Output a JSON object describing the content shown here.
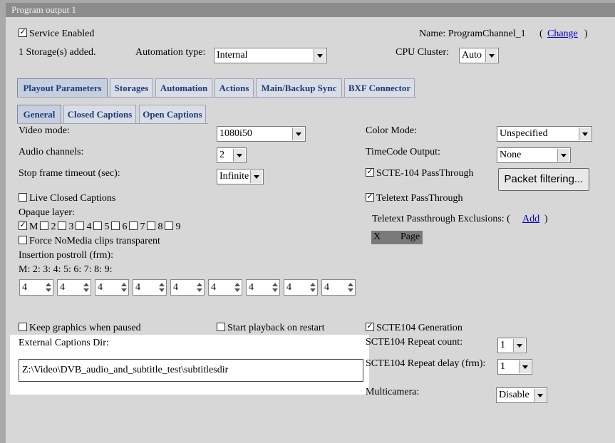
{
  "window": {
    "title": "Program output 1"
  },
  "header": {
    "service_enabled": "Service Enabled",
    "storages_added": "1 Storage(s) added.",
    "automation_type_label": "Automation type:",
    "automation_type_value": "Internal",
    "name_label": "Name: ProgramChannel_1",
    "paren_open": "(",
    "change_link": "Change",
    "paren_close": ")",
    "cpu_cluster_label": "CPU Cluster:",
    "cpu_cluster_value": "Auto"
  },
  "tabs_main": [
    "Playout Parameters",
    "Storages",
    "Automation",
    "Actions",
    "Main/Backup Sync",
    "BXF Connector"
  ],
  "tabs_sub": [
    "General",
    "Closed Captions",
    "Open Captions"
  ],
  "left": {
    "video_mode_label": "Video mode:",
    "video_mode_value": "1080i50",
    "audio_channels_label": "Audio channels:",
    "audio_channels_value": "2",
    "stop_frame_label": "Stop frame timeout (sec):",
    "stop_frame_value": "Infinite",
    "live_cc": "Live Closed Captions",
    "opaque_layer_label": "Opaque layer:",
    "opaque_layers": [
      "M",
      "2",
      "3",
      "4",
      "5",
      "6",
      "7",
      "8",
      "9"
    ],
    "force_nomedia": "Force NoMedia clips transparent",
    "insertion_postroll_label": "Insertion postroll (frm):",
    "postroll_keys": "M: 2: 3: 4: 5: 6: 7: 8: 9:",
    "postroll_values": [
      "4",
      "4",
      "4",
      "4",
      "4",
      "4",
      "4",
      "4",
      "4"
    ],
    "keep_graphics": "Keep graphics when paused",
    "start_playback": "Start playback on restart",
    "ext_captions_label": "External Captions Dir:",
    "ext_captions_value": "Z:\\Video\\DVB_audio_and_subtitle_test\\subtitlesdir"
  },
  "right": {
    "color_mode_label": "Color Mode:",
    "color_mode_value": "Unspecified",
    "timecode_output_label": "TimeCode Output:",
    "timecode_output_value": "None",
    "scte104_passthrough": "SCTE-104 PassThrough",
    "packet_filtering": "Packet filtering...",
    "teletext_passthrough": "Teletext PassThrough",
    "teletext_exclusions_label": "Teletext Passthrough Exclusions: (",
    "add_link": "Add",
    "paren_close": ")",
    "excl_col_x": "X",
    "excl_col_page": "Page",
    "scte104_generation": "SCTE104 Generation",
    "scte104_repeat_count_label": "SCTE104 Repeat count:",
    "scte104_repeat_count_value": "1",
    "scte104_repeat_delay_label": "SCTE104 Repeat delay (frm):",
    "scte104_repeat_delay_value": "1",
    "multicamera_label": "Multicamera:",
    "multicamera_value": "Disable"
  }
}
